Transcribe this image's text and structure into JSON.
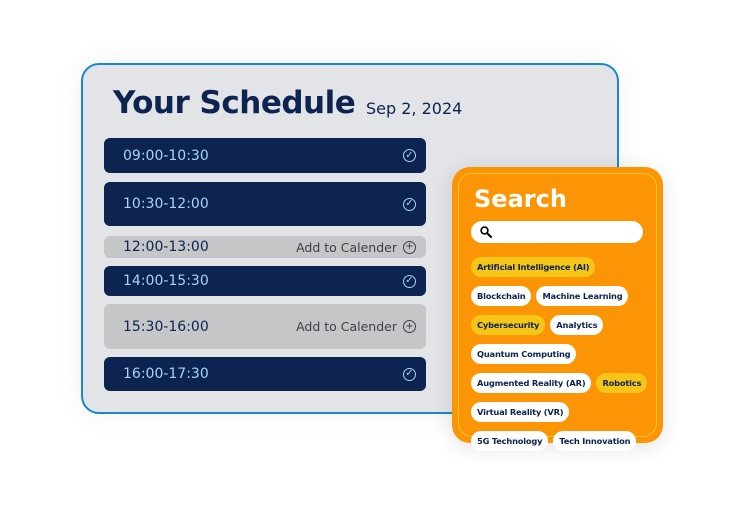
{
  "schedule": {
    "title": "Your Schedule",
    "date": "Sep 2, 2024",
    "slots": [
      {
        "time": "09:00-10:30",
        "status": "booked",
        "icon": "check-circle-icon"
      },
      {
        "time": "10:30-12:00",
        "status": "booked",
        "icon": "check-circle-icon"
      },
      {
        "time": "12:00-13:00",
        "status": "free",
        "action": "Add to Calender",
        "icon": "plus-circle-icon"
      },
      {
        "time": "14:00-15:30",
        "status": "booked",
        "icon": "check-circle-icon"
      },
      {
        "time": "15:30-16:00",
        "status": "free",
        "action": "Add to Calender",
        "icon": "plus-circle-icon"
      },
      {
        "time": "16:00-17:30",
        "status": "booked",
        "icon": "check-circle-icon"
      }
    ]
  },
  "search": {
    "title": "Search",
    "input_value": "",
    "icon": "search-icon",
    "tags": [
      {
        "label": "Artificial Intelligence (AI)",
        "selected": true
      },
      {
        "label": "Blockchain",
        "selected": false
      },
      {
        "label": "Machine Learning",
        "selected": false
      },
      {
        "label": "Cybersecurity",
        "selected": true
      },
      {
        "label": "Analytics",
        "selected": false
      },
      {
        "label": "Quantum Computing",
        "selected": false
      },
      {
        "label": "Augmented Reality (AR)",
        "selected": false
      },
      {
        "label": "Robotics",
        "selected": true
      },
      {
        "label": "Virtual Reality (VR)",
        "selected": false
      },
      {
        "label": "5G Technology",
        "selected": false
      },
      {
        "label": "Tech Innovation",
        "selected": false
      }
    ]
  },
  "colors": {
    "navy": "#0d2350",
    "accent_blue": "#1a86d0",
    "orange": "#fb9505",
    "highlight": "#f5c518"
  }
}
